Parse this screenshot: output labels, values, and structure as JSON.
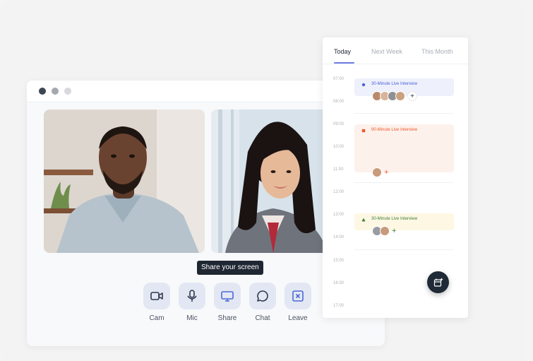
{
  "call": {
    "tooltip": "Share your screen",
    "controls": [
      {
        "label": "Cam",
        "icon": "camera-icon"
      },
      {
        "label": "Mic",
        "icon": "microphone-icon"
      },
      {
        "label": "Share",
        "icon": "screen-share-icon"
      },
      {
        "label": "Chat",
        "icon": "chat-bubble-icon"
      },
      {
        "label": "Leave",
        "icon": "leave-x-icon"
      }
    ]
  },
  "calendar": {
    "tabs": [
      "Today",
      "Next Week",
      "This Month"
    ],
    "active_tab": "Today",
    "times": [
      "07:00",
      "08:00",
      "09:00",
      "10:00",
      "11:00",
      "12:00",
      "13:00",
      "14:00",
      "15:00",
      "16:30",
      "17:00"
    ],
    "events": [
      {
        "title": "30-Minute Live Interview",
        "color": "#4d61d7",
        "marker": "circle"
      },
      {
        "title": "90-Minute Live Interview",
        "color": "#f0582b",
        "marker": "square"
      },
      {
        "title": "30-Minute Live Interview",
        "color": "#3f7f35",
        "marker": "triangle"
      }
    ],
    "add_label": "+"
  },
  "colors": {
    "accent": "#6d7de3",
    "control_bg": "#e3e7f3",
    "control_icon": "#2f3a4f",
    "share_icon": "#4a6ad6",
    "leave_icon": "#4a6ad6",
    "fab_bg": "#1f2a36"
  }
}
